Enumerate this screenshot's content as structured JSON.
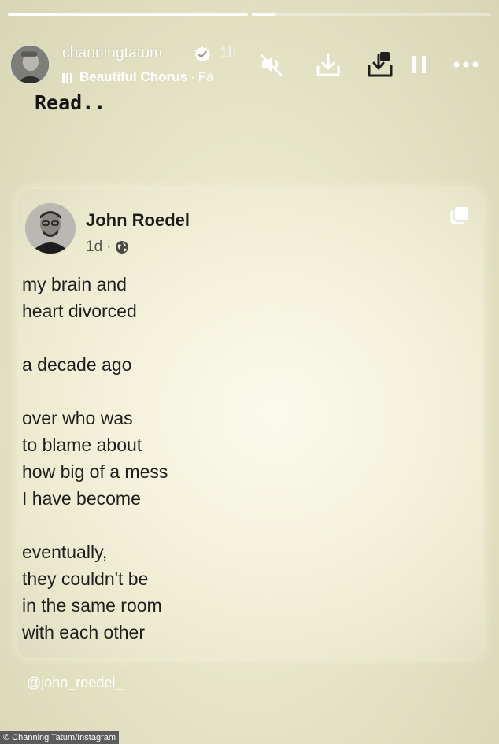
{
  "story": {
    "progress": [
      1.0,
      0.1
    ]
  },
  "header": {
    "username": "channingtatum",
    "time": "1h",
    "music_title": "Beautiful Chorus",
    "music_separator": "·",
    "music_subtitle": "Fa",
    "icons": [
      "mute-icon",
      "download-icon",
      "save-icon",
      "pause-icon",
      "more-icon",
      "verified-badge-icon",
      "music-bars-icon"
    ]
  },
  "caption": "Read..",
  "post": {
    "author": "John Roedel",
    "age": "1d",
    "dot": "·",
    "stanzas": [
      [
        "my brain and",
        "heart divorced"
      ],
      [
        "a decade ago"
      ],
      [
        "over who was",
        "to blame about",
        "how big of a mess",
        "I have become"
      ],
      [
        "eventually,",
        "they couldn't be",
        "in the same room",
        "with each other"
      ]
    ]
  },
  "mention": "@john_roedel_",
  "credit": "© Channing Tatum/Instagram",
  "colors": {
    "background": "#e7e6c8",
    "card": "#f5f3dd",
    "text": "#1e1e1e",
    "overlay_text": "#ffffff",
    "verified": "#ffffff"
  }
}
